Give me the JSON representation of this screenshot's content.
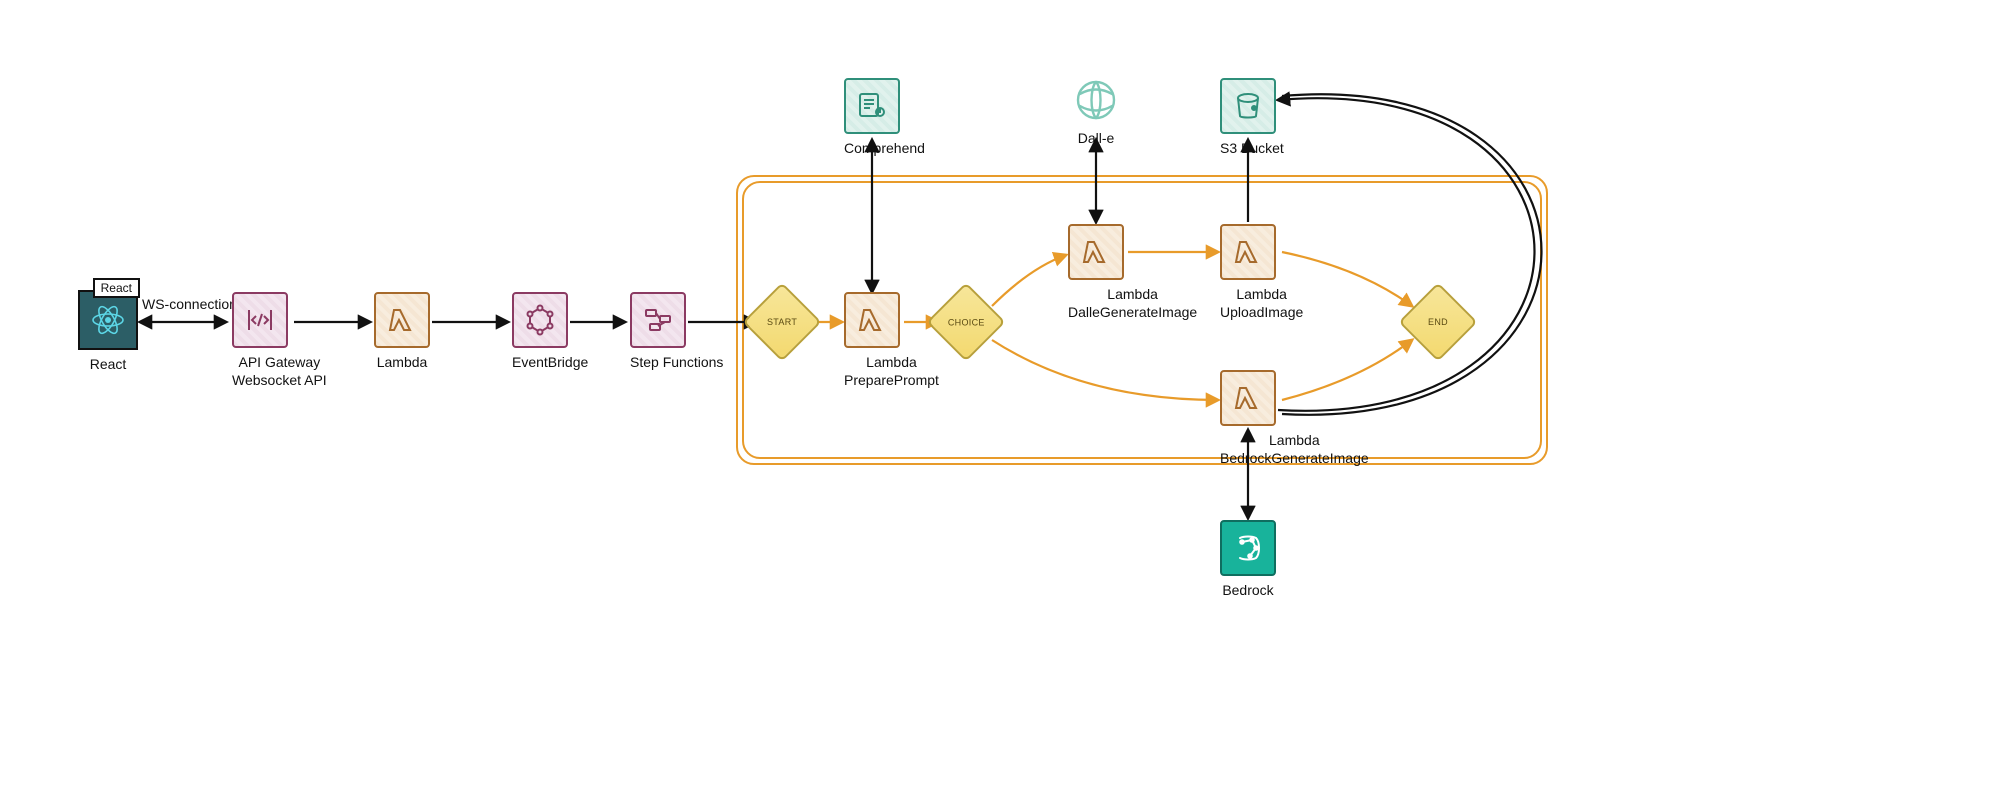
{
  "edge_labels": {
    "ws_connection": "WS-connection"
  },
  "nodes": {
    "react": {
      "badge": "React",
      "label": "React"
    },
    "api_gateway": {
      "label1": "API Gateway",
      "label2": "Websocket API"
    },
    "lambda_main": {
      "label": "Lambda"
    },
    "eventbridge": {
      "label": "EventBridge"
    },
    "stepfunctions": {
      "label": "Step Functions"
    },
    "start": {
      "text": "START"
    },
    "choice": {
      "text": "CHOICE"
    },
    "end": {
      "text": "END"
    },
    "lambda_prepare": {
      "label1": "Lambda",
      "label2": "PreparePrompt"
    },
    "lambda_dalle": {
      "label1": "Lambda",
      "label2": "DalleGenerateImage"
    },
    "lambda_upload": {
      "label1": "Lambda",
      "label2": "UploadImage"
    },
    "lambda_bedrock": {
      "label1": "Lambda",
      "label2": "BedrockGenerateImage"
    },
    "comprehend": {
      "label": "Comprehend"
    },
    "dalle": {
      "label": "Dall-e"
    },
    "s3": {
      "label": "S3 Bucket"
    },
    "bedrock": {
      "label": "Bedrock"
    }
  },
  "colors": {
    "sf_border": "#e89b2a",
    "diamond_fill": "#f3d96f",
    "arrow_black": "#111111",
    "arrow_orange": "#e89b2a"
  }
}
